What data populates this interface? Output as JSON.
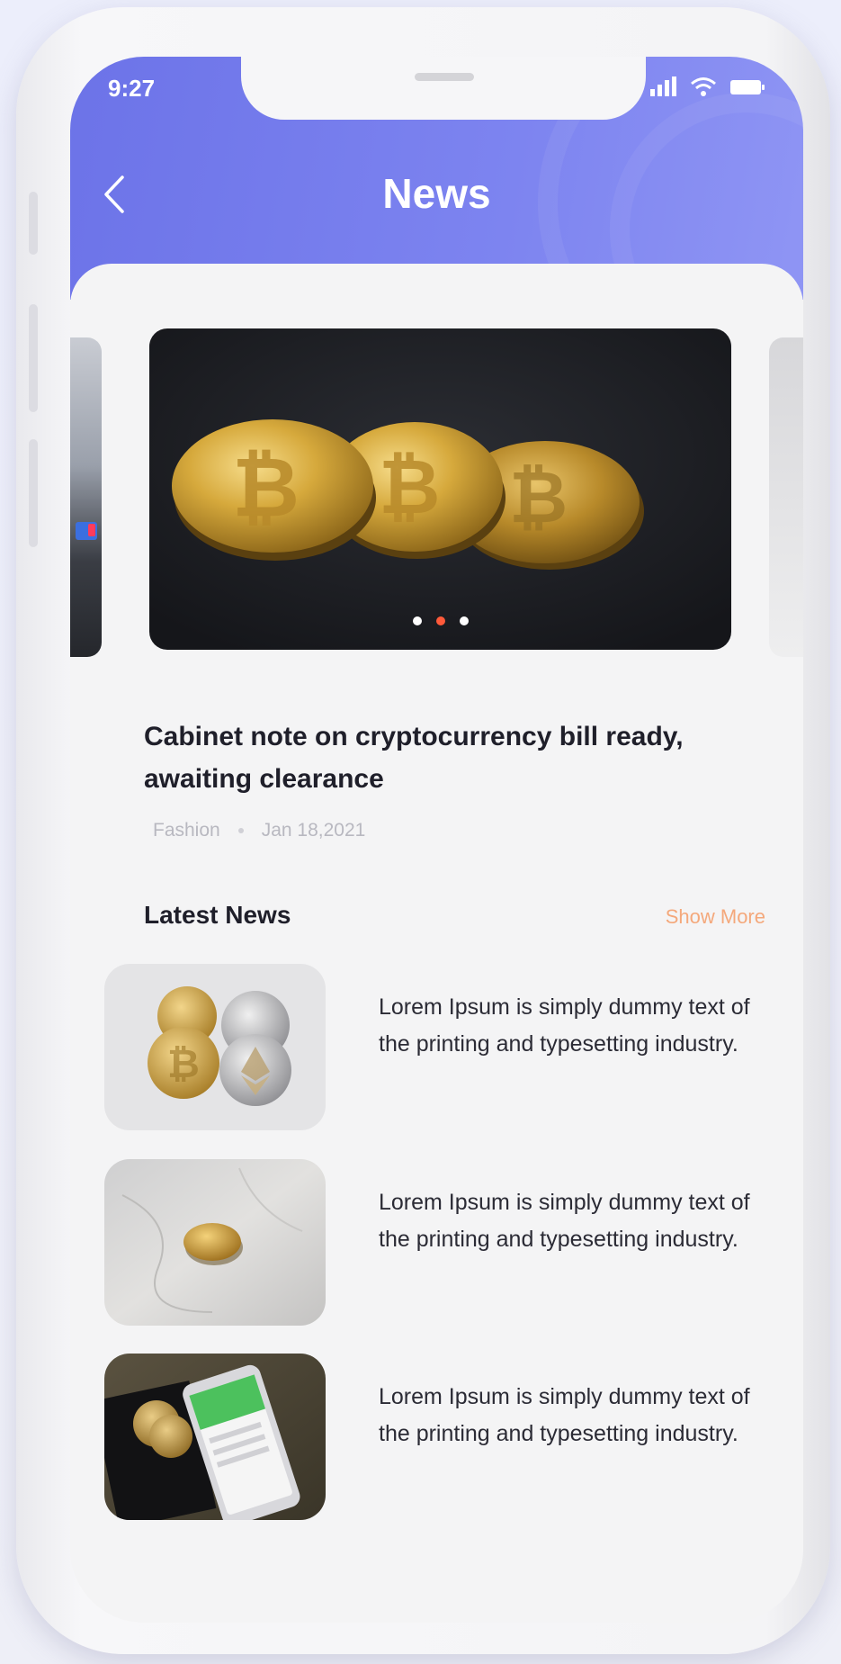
{
  "status_bar": {
    "time": "9:27"
  },
  "header": {
    "title": "News"
  },
  "carousel": {
    "active_index": 1,
    "slide_count": 3,
    "headline": "Cabinet note on cryptocurrency bill ready, awaiting clearance",
    "category": "Fashion",
    "date": "Jan 18,2021"
  },
  "latest": {
    "title": "Latest News",
    "show_more": "Show More",
    "items": [
      {
        "text": "Lorem Ipsum is simply dummy text of the printing and typesetting industry."
      },
      {
        "text": "Lorem Ipsum is simply dummy text of the printing and typesetting industry."
      },
      {
        "text": "Lorem Ipsum is simply dummy text of the printing and typesetting industry."
      }
    ]
  },
  "colors": {
    "header_start": "#6c73e8",
    "header_end": "#8f95f4",
    "accent": "#f4a87b",
    "active_dot": "#ff5a3a"
  }
}
